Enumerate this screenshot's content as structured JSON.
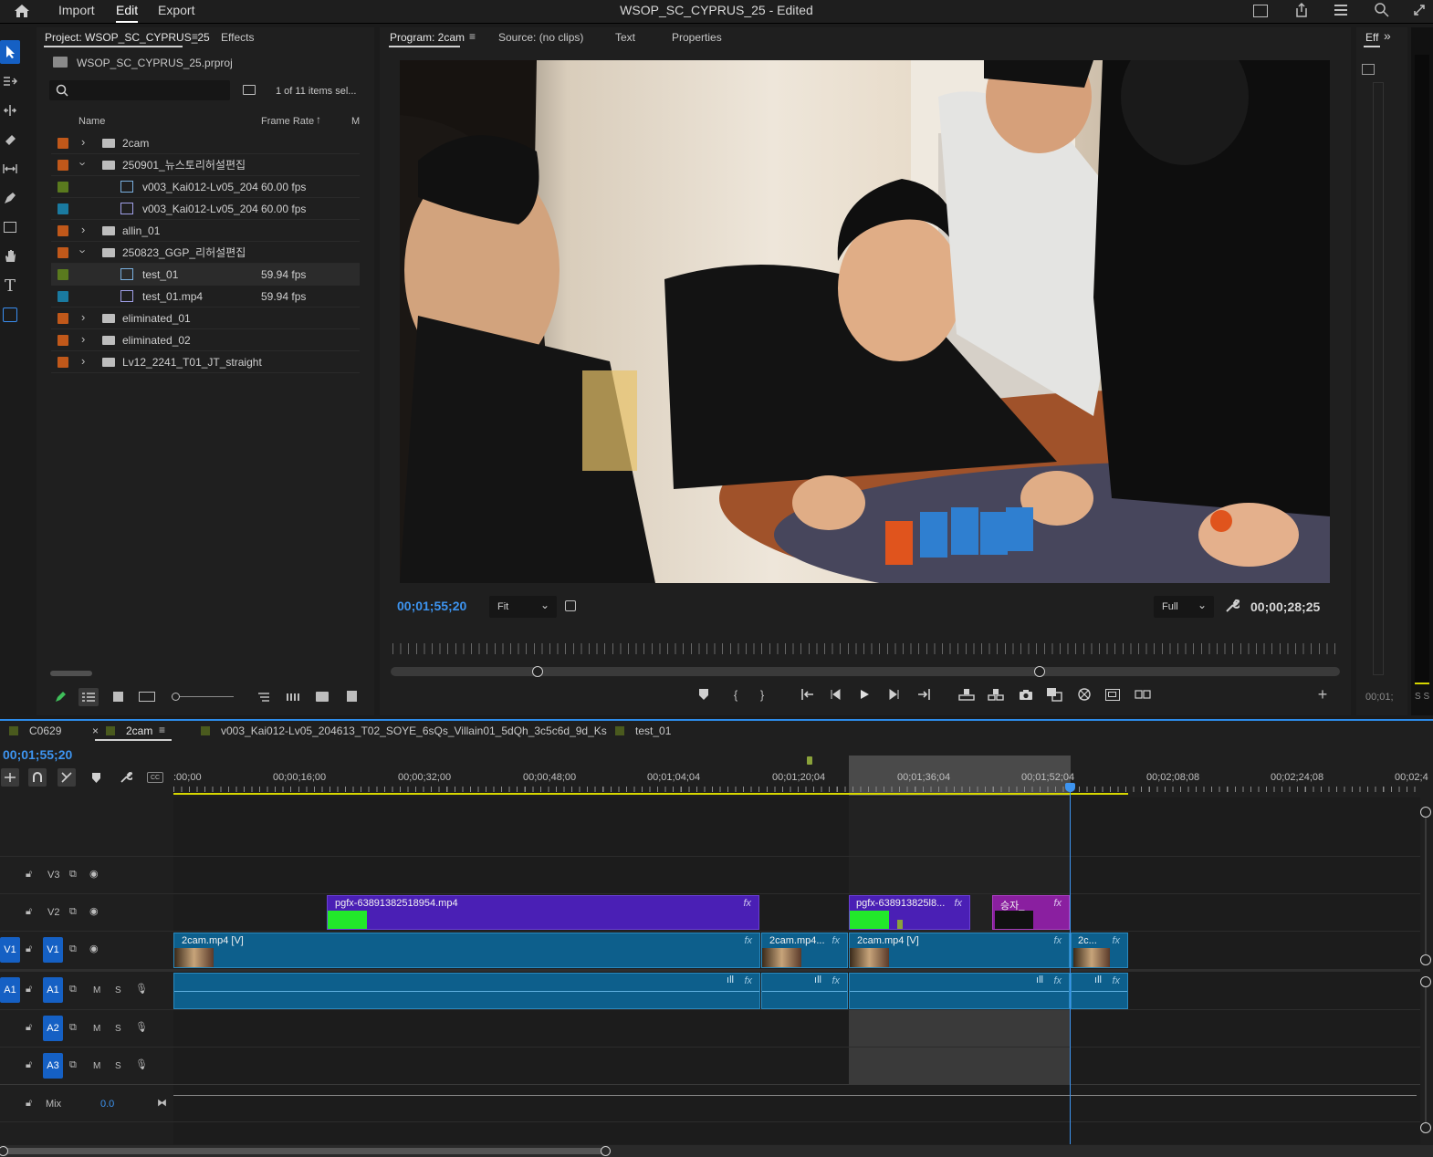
{
  "app": {
    "menu": [
      "Import",
      "Edit",
      "Export"
    ],
    "title": "WSOP_SC_CYPRUS_25 - Edited"
  },
  "project_panel": {
    "tab_project": "Project: WSOP_SC_CYPRUS_25",
    "tab_effects": "Effects",
    "file_name": "WSOP_SC_CYPRUS_25.prproj",
    "search_placeholder": "",
    "items_selected": "1 of 11 items sel...",
    "col_name": "Name",
    "col_frame_rate": "Frame Rate",
    "col_m": "M",
    "rows": [
      {
        "name": "2cam",
        "fps": "",
        "color": "#c0581a",
        "kind": "folder",
        "expanded": false
      },
      {
        "name": "250901_뉴스토리허설편집",
        "fps": "",
        "color": "#c0581a",
        "kind": "folder",
        "expanded": true
      },
      {
        "name": "v003_Kai012-Lv05_204",
        "fps": "60.00 fps",
        "color": "#5a7a1e",
        "kind": "sequence"
      },
      {
        "name": "v003_Kai012-Lv05_204",
        "fps": "60.00 fps",
        "color": "#1a7aa0",
        "kind": "media"
      },
      {
        "name": "allin_01",
        "fps": "",
        "color": "#c0581a",
        "kind": "folder",
        "expanded": false
      },
      {
        "name": "250823_GGP_리허설편집",
        "fps": "",
        "color": "#c0581a",
        "kind": "folder",
        "expanded": true
      },
      {
        "name": "test_01",
        "fps": "59.94 fps",
        "color": "#5a7a1e",
        "kind": "sequence"
      },
      {
        "name": "test_01.mp4",
        "fps": "59.94 fps",
        "color": "#1a7aa0",
        "kind": "media"
      },
      {
        "name": "eliminated_01",
        "fps": "",
        "color": "#c0581a",
        "kind": "folder",
        "expanded": false
      },
      {
        "name": "eliminated_02",
        "fps": "",
        "color": "#c0581a",
        "kind": "folder",
        "expanded": false
      },
      {
        "name": "Lv12_2241_T01_JT_straight",
        "fps": "",
        "color": "#c0581a",
        "kind": "folder",
        "expanded": false
      }
    ]
  },
  "program_monitor": {
    "tab_program": "Program: 2cam",
    "tab_source": "Source: (no clips)",
    "tab_text": "Text",
    "tab_properties": "Properties",
    "timecode": "00;01;55;20",
    "zoom": "Fit",
    "quality": "Full",
    "duration": "00;00;28;25"
  },
  "right_panel": {
    "tab": "Eff",
    "timecode_fragment": "00;01;",
    "labels": "S S"
  },
  "timeline": {
    "tabs": [
      "C0629",
      "2cam",
      "v003_Kai012-Lv05_204613_T02_SOYE_6sQs_Villain01_5dQh_3c5c6d_9d_Ks",
      "test_01"
    ],
    "timecode": "00;01;55;20",
    "ruler": [
      ":00;00",
      "00;00;16;00",
      "00;00;32;00",
      "00;00;48;00",
      "00;01;04;04",
      "00;01;20;04",
      "00;01;36;04",
      "00;01;52;04",
      "00;02;08;08",
      "00;02;24;08",
      "00;02;4"
    ],
    "tracks": {
      "v3": "V3",
      "v2": "V2",
      "v1": "V1",
      "a1": "A1",
      "a2": "A2",
      "a3": "A3",
      "mix": "Mix",
      "mix_value": "0.0",
      "m": "M",
      "s": "S"
    },
    "clips": {
      "v2_a": "pgfx-63891382518954.mp4",
      "v2_b": "pgfx-638913825l8...",
      "v2_c": "승자_",
      "v1_a": "2cam.mp4 [V]",
      "v1_b": "2cam.mp4...",
      "v1_c": "2cam.mp4 [V]",
      "v1_d": "2c...",
      "fx": "fx"
    }
  },
  "colors": {
    "accent": "#2d8ceb",
    "video_clip": "#0d5f8c",
    "gfx_clip": "#4a1fb5",
    "gfx_clip_2": "#8a1fa0",
    "green_block": "#22e82a"
  }
}
